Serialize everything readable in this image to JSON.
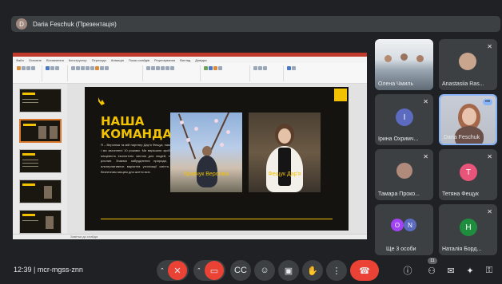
{
  "presentation_bar": {
    "presenter_initial": "D",
    "label": "Daria Feschuk (Презентація)"
  },
  "powerpoint": {
    "ribbon_tabs": [
      "Файл",
      "Основне",
      "Вставлення",
      "Конструктор",
      "Переходи",
      "Анімація",
      "Показ слайдів",
      "Рецензування",
      "Вигляд",
      "Довідка"
    ],
    "status_notes": "Замітки до слайда"
  },
  "slide": {
    "title_line1": "НАША",
    "title_line2": "КОМАНДА",
    "body": "Я – Вероніка та мій партнер Дар'я Фещук, нам 10 років, і ми захопленi 10 роками. Ми вирішили зробити свою місцевість екологічно чистою для людей, тварин та рослин. Знаємо забруднення природи, шукаємо альтернативних варіантів утилізації сміття, зробити безпечним місцем для життя всіх.",
    "caption_left": "Кравчук Вероніка",
    "caption_right": "Фещук Дар'я",
    "accent_color": "#f2c200"
  },
  "participants": [
    {
      "name": "Олена Чмиль",
      "kind": "video"
    },
    {
      "name": "Anastasiia Ras...",
      "kind": "photo"
    },
    {
      "name": "Ірина Охримч...",
      "initial": "І",
      "color": "#5c6bc0"
    },
    {
      "name": "Daria Feschuk",
      "kind": "video",
      "active": true
    },
    {
      "name": "Тамара Проко...",
      "kind": "photo"
    },
    {
      "name": "Тетяна Фещук",
      "initial": "Т",
      "color": "#e8547a"
    },
    {
      "name": "Ще 3 особи",
      "initials": [
        "O",
        "N"
      ]
    },
    {
      "name": "Наталія Борд...",
      "initial": "Н",
      "color": "#1e8e3e"
    }
  ],
  "bottom_bar": {
    "time": "12:39",
    "meeting_code": "mcr-mgss-znn",
    "people_count": "11"
  }
}
